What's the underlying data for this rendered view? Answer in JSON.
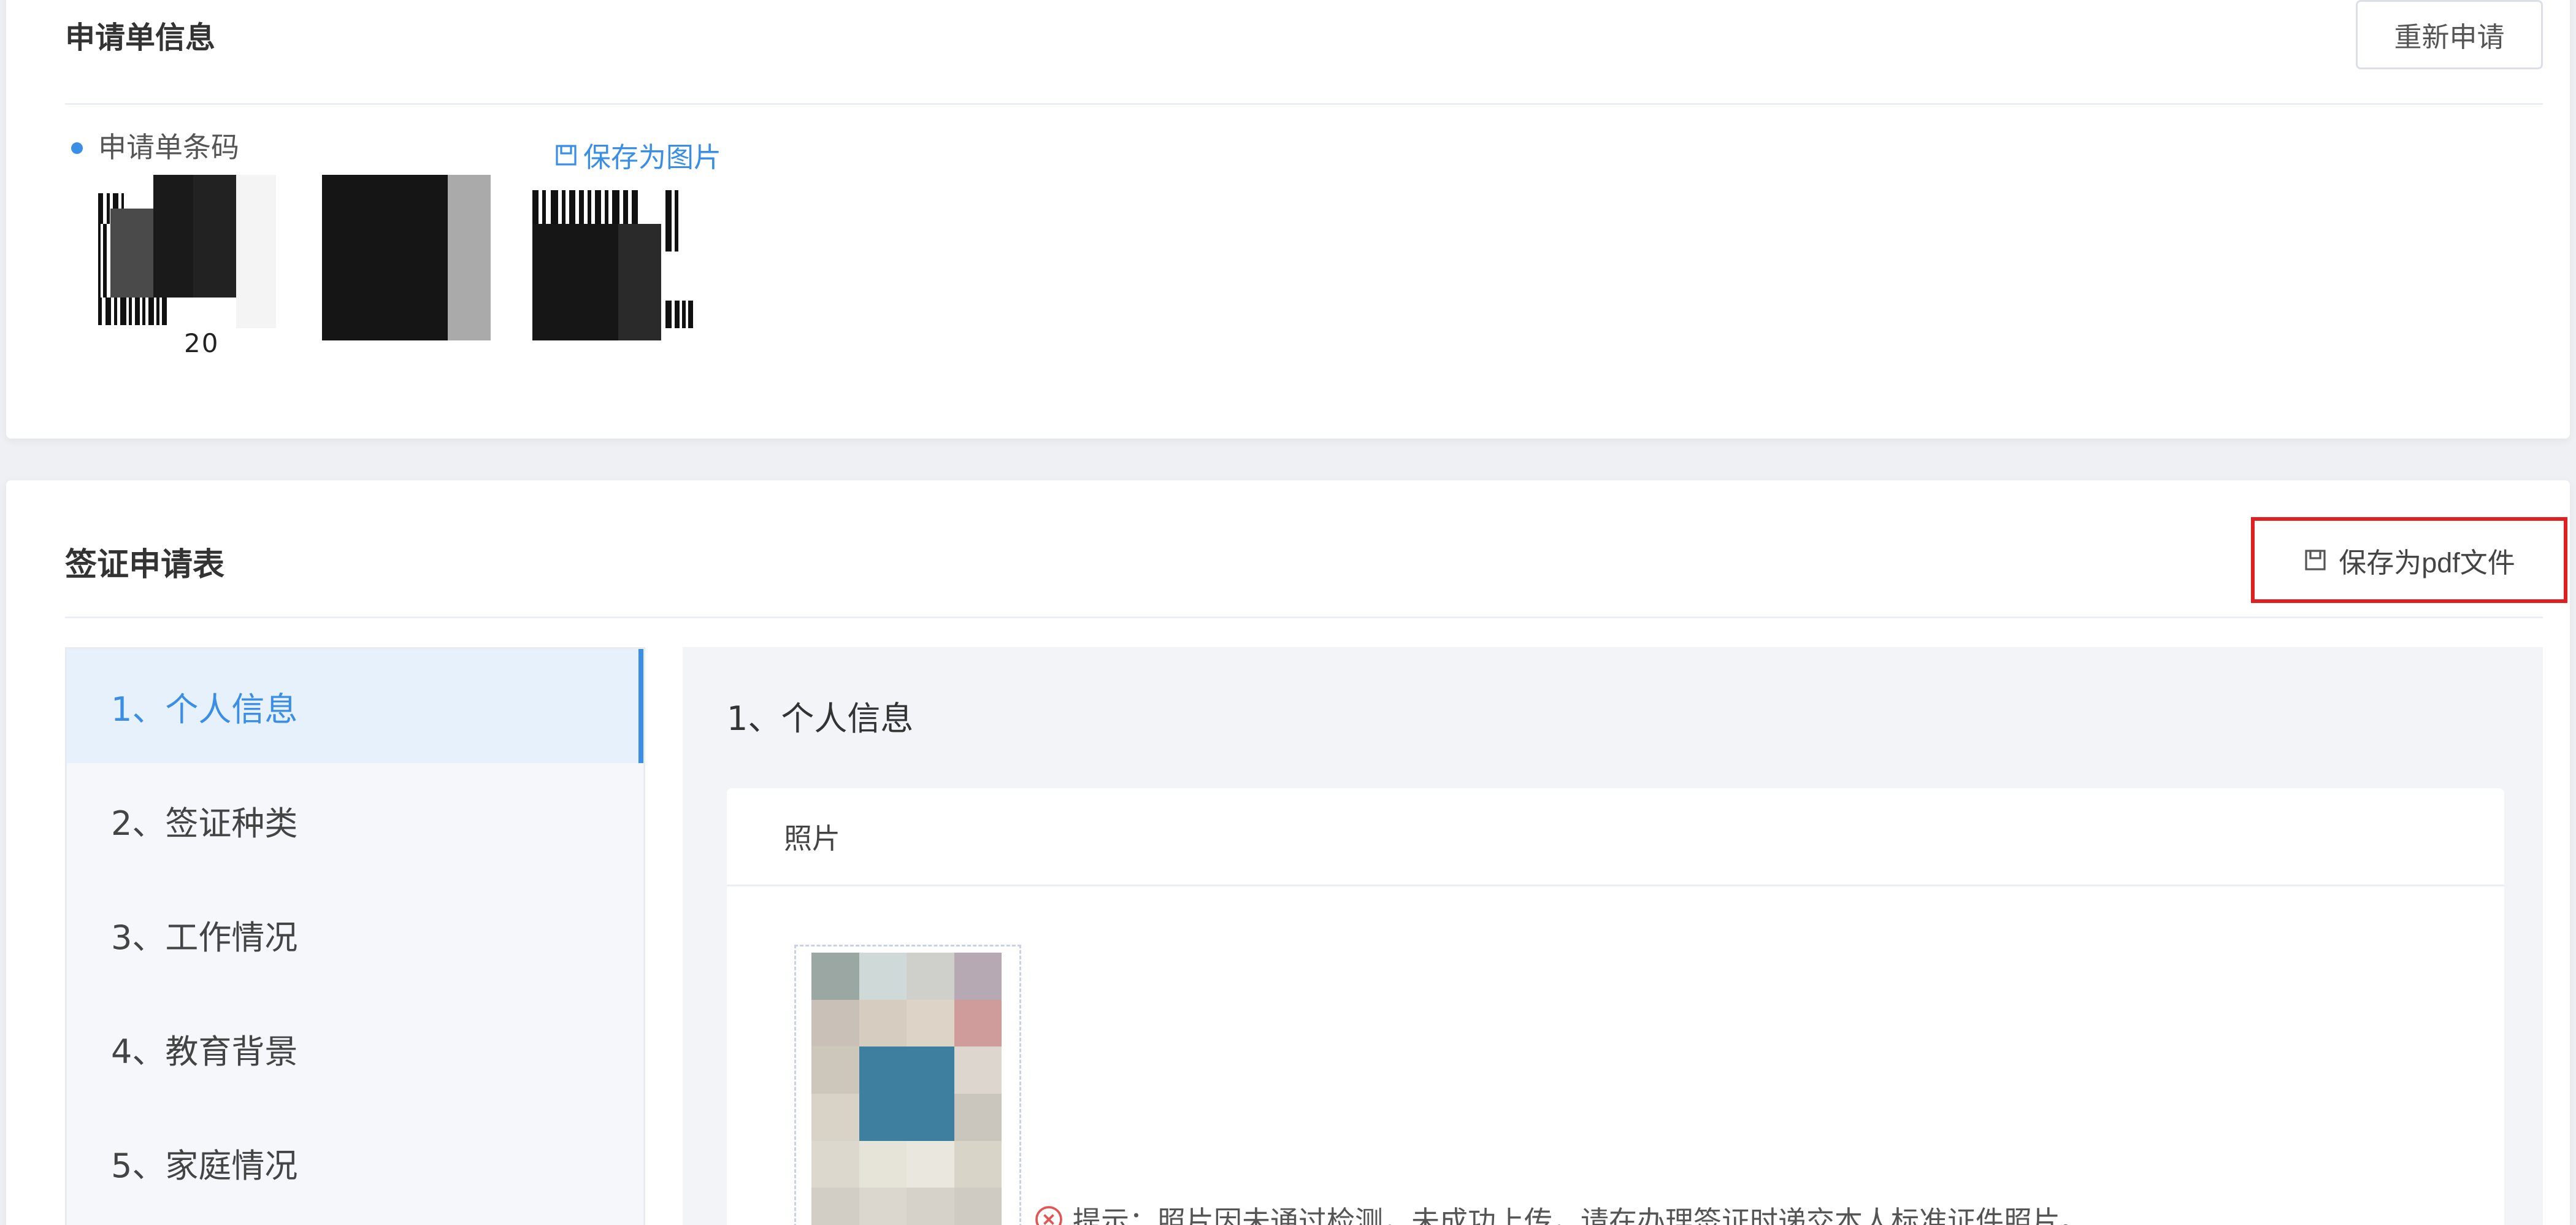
{
  "application_info": {
    "title": "申请单信息",
    "reapply_button": "重新申请",
    "barcode_label": "申请单条码",
    "save_as_image": "保存为图片",
    "barcode_number_visible": "20"
  },
  "visa_form": {
    "title": "签证申请表",
    "save_pdf_button": "保存为pdf文件",
    "nav_items": [
      {
        "label": "1、个人信息",
        "active": true
      },
      {
        "label": "2、签证种类",
        "active": false
      },
      {
        "label": "3、工作情况",
        "active": false
      },
      {
        "label": "4、教育背景",
        "active": false
      },
      {
        "label": "5、家庭情况",
        "active": false
      }
    ],
    "section_title": "1、个人信息",
    "photo_card_header": "照片",
    "hint_text": "提示：照片因未通过检测，未成功上传，请在办理签证时递交本人标准证件照片。"
  },
  "colors": {
    "accent": "#3a8ee6",
    "highlight_border": "#e02020",
    "error_icon": "#e25555"
  },
  "icons": {
    "save_image": "save-icon",
    "save_pdf": "save-icon",
    "hint": "close-circle-icon"
  }
}
